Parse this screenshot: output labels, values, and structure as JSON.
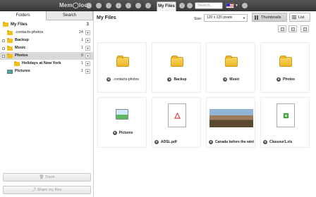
{
  "app": {
    "logo": "Mem◯loo"
  },
  "topbar": {
    "active_tab": "My Files",
    "search_placeholder": "Search...",
    "language": "en-US"
  },
  "sidebar": {
    "tabs": [
      {
        "label": "Folders"
      },
      {
        "label": "Search"
      }
    ],
    "items": [
      {
        "label": "My Files",
        "count": "3"
      },
      {
        "label": ".contacts-photos",
        "count": "24"
      },
      {
        "label": "Backup",
        "count": "1"
      },
      {
        "label": "Music",
        "count": "1"
      },
      {
        "label": "Photos",
        "count": "0"
      },
      {
        "label": "Holidays at New York",
        "count": "1"
      },
      {
        "label": "Pictures",
        "count": "1"
      }
    ],
    "trash_label": "Trash",
    "share_label": "Share my files"
  },
  "main": {
    "title": "My Files",
    "size_label": "Size:",
    "size_value": "120 x 120 pixels",
    "view_thumbnails": "Thumbnails",
    "view_list": "List",
    "items": [
      {
        "name": ".contacts-photos",
        "type": "folder"
      },
      {
        "name": "Backup",
        "type": "folder"
      },
      {
        "name": "Music",
        "type": "folder"
      },
      {
        "name": "Photos",
        "type": "folder"
      },
      {
        "name": "Pictures",
        "type": "picture-folder"
      },
      {
        "name": "ADSL.pdf",
        "type": "pdf"
      },
      {
        "name": "Canada before the wint",
        "type": "photo"
      },
      {
        "name": "Classeur1.xls",
        "type": "xls"
      }
    ]
  },
  "colors": {
    "topbar": "#444444",
    "folder": "#f0c020",
    "selected_row": "#d9d9d9"
  }
}
